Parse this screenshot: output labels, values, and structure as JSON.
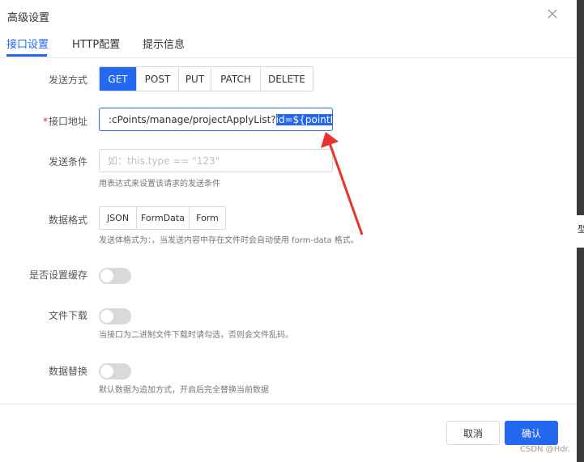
{
  "dialog": {
    "title": "高级设置",
    "close_icon": "close-icon"
  },
  "tabs": [
    {
      "label": "接口设置",
      "active": true
    },
    {
      "label": "HTTP配置",
      "active": false
    },
    {
      "label": "提示信息",
      "active": false
    }
  ],
  "form": {
    "method": {
      "label": "发送方式",
      "options": [
        "GET",
        "POST",
        "PUT",
        "PATCH",
        "DELETE"
      ],
      "selected": "GET"
    },
    "url": {
      "required_mark": "*",
      "label": "接口地址",
      "value_before": ":cPoints/manage/projectApplyList?",
      "value_selected": "id=${pointId}"
    },
    "condition": {
      "label": "发送条件",
      "placeholder": "如：this.type == \"123\"",
      "hint": "用表达式来设置该请求的发送条件"
    },
    "data_format": {
      "label": "数据格式",
      "options": [
        "JSON",
        "FormData",
        "Form"
      ],
      "hint": "发送体格式为：，当发送内容中存在文件时会自动使用 form-data 格式。"
    },
    "cache": {
      "label": "是否设置缓存",
      "on": false
    },
    "download": {
      "label": "文件下载",
      "on": false,
      "hint": "当接口为二进制文件下载时请勾选，否则会文件乱码。"
    },
    "replace": {
      "label": "数据替换",
      "on": false,
      "hint": "默认数据为追加方式，开启后完全替换当前数据"
    }
  },
  "footer": {
    "cancel_label": "取消",
    "confirm_label": "确认"
  },
  "watermark": "CSDN @Hdr.",
  "side_glyph": "型",
  "colors": {
    "primary": "#2468f2",
    "annotation_arrow": "#e8332a"
  }
}
